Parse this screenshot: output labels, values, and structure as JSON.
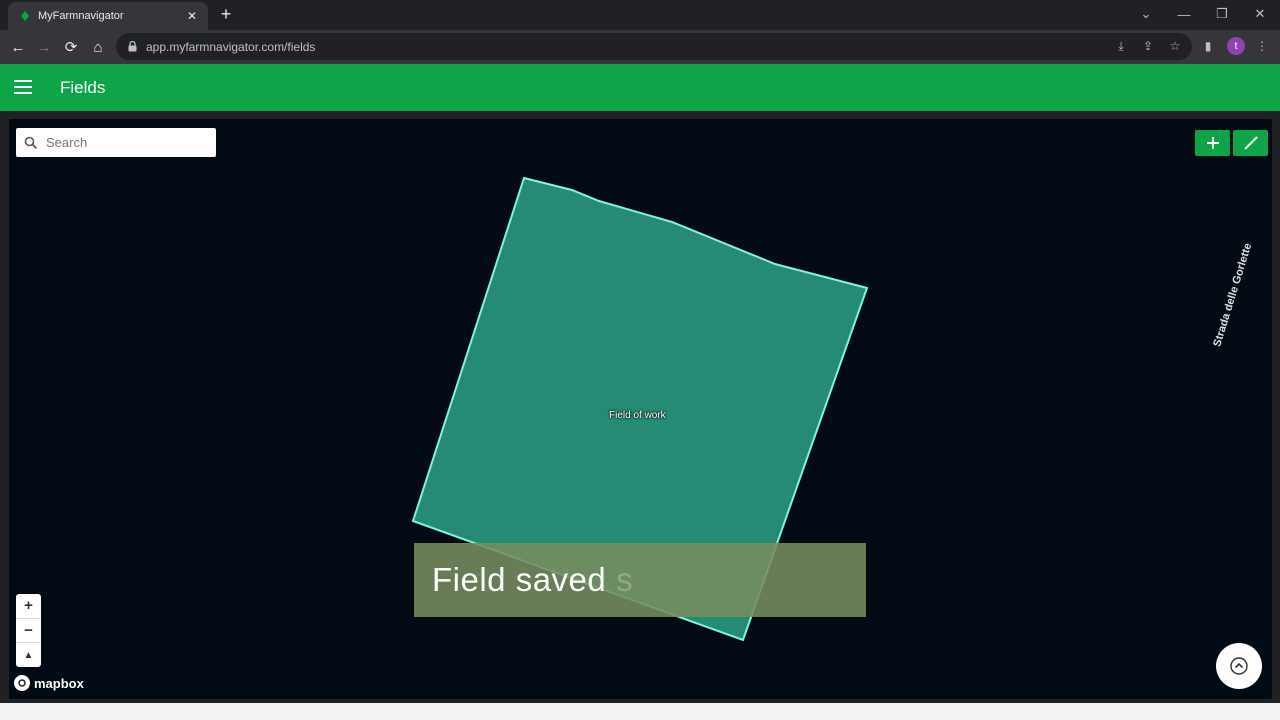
{
  "browser": {
    "tab_title": "MyFarmnavigator",
    "url": "app.myfarmnavigator.com/fields",
    "profile_initial": "t"
  },
  "app": {
    "title": "Fields",
    "brand_color": "#0ea548"
  },
  "map": {
    "search_placeholder": "Search",
    "field_label": "Field of work",
    "road_label": "Strada delle Gorlette",
    "toast_text": "Field saved",
    "toast_fading_text": "s",
    "zoom_in_label": "+",
    "zoom_out_label": "−",
    "compass_label": "▲",
    "attribution": "mapbox",
    "field_fill_color": "#2a9d82",
    "field_stroke_color": "#7ef5dc"
  }
}
